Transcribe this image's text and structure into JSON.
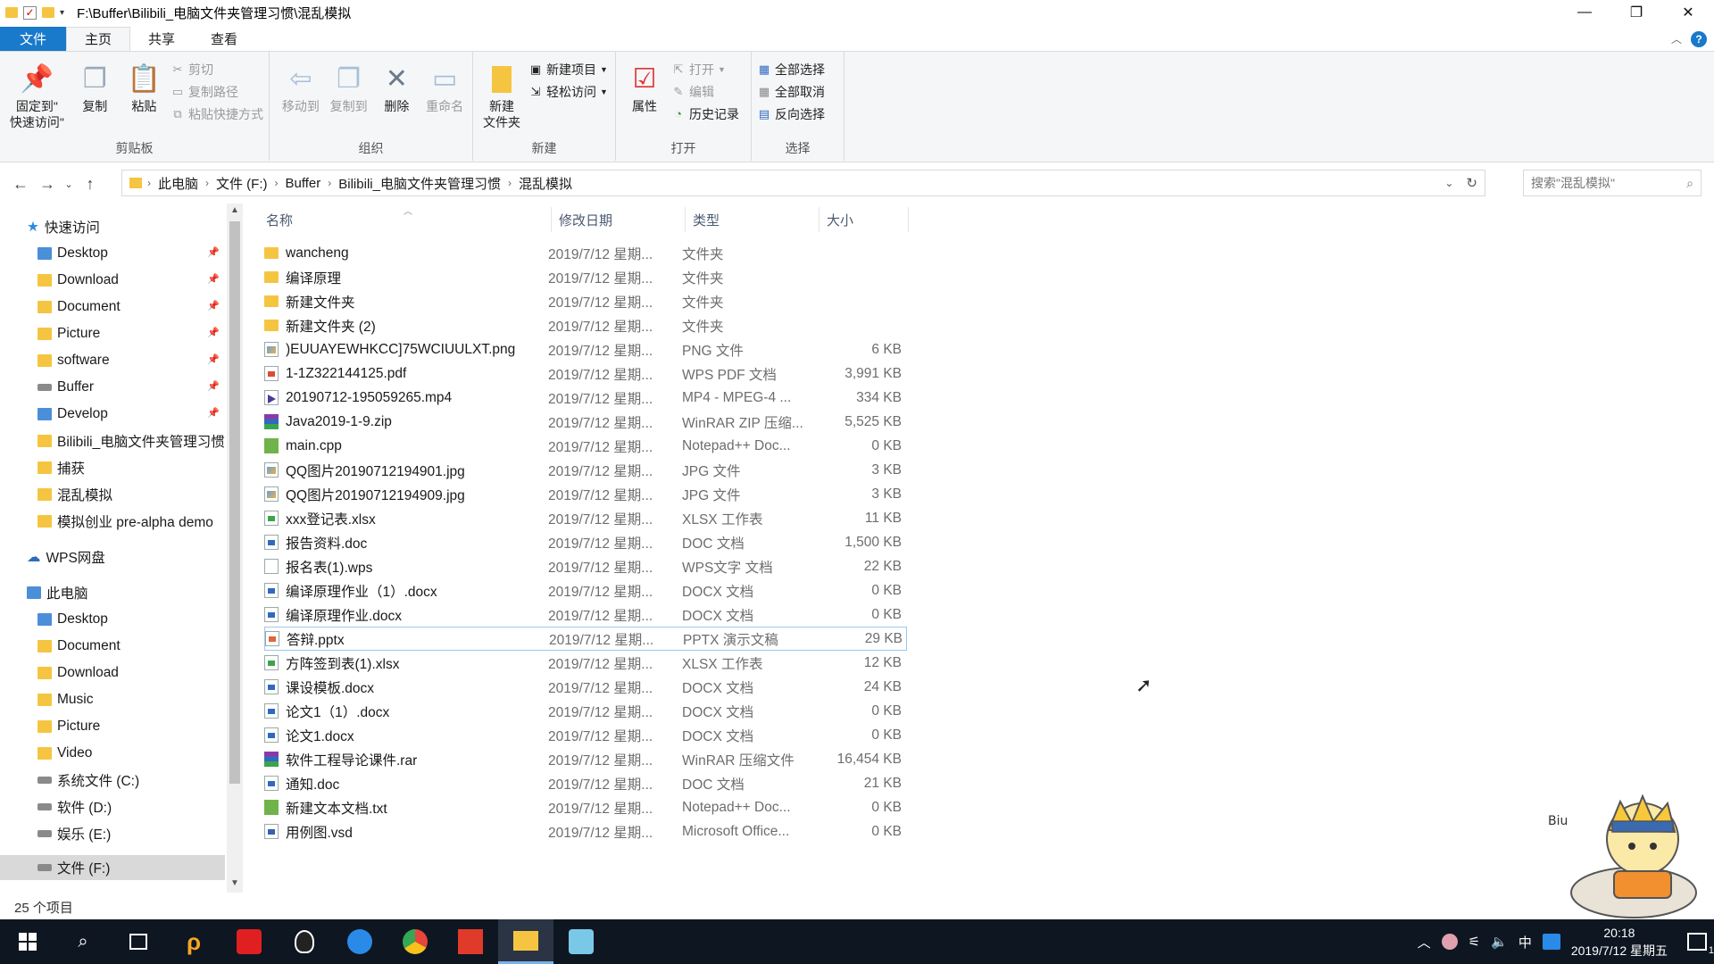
{
  "window": {
    "title": "F:\\Buffer\\Bilibili_电脑文件夹管理习惯\\混乱模拟",
    "controls": [
      "minimize",
      "restore",
      "close"
    ]
  },
  "tabs": [
    {
      "label": "文件"
    },
    {
      "label": "主页"
    },
    {
      "label": "共享"
    },
    {
      "label": "查看"
    }
  ],
  "ribbon": {
    "clipboard": {
      "label": "剪贴板",
      "pin_quick": "固定到\"\n快速访问\"",
      "copy": "复制",
      "paste": "粘贴",
      "cut": "剪切",
      "copy_path": "复制路径",
      "paste_shortcut": "粘贴快捷方式"
    },
    "organize": {
      "label": "组织",
      "move_to": "移动到",
      "copy_to": "复制到",
      "delete": "删除",
      "rename": "重命名"
    },
    "new": {
      "label": "新建",
      "new_folder": "新建\n文件夹",
      "new_item": "新建项目",
      "easy_access": "轻松访问"
    },
    "open": {
      "label": "打开",
      "properties": "属性",
      "open": "打开",
      "edit": "编辑",
      "history": "历史记录"
    },
    "select": {
      "label": "选择",
      "select_all": "全部选择",
      "select_none": "全部取消",
      "invert": "反向选择"
    }
  },
  "address": {
    "crumbs": [
      "此电脑",
      "文件 (F:)",
      "Buffer",
      "Bilibili_电脑文件夹管理习惯",
      "混乱模拟"
    ],
    "search_placeholder": "搜索\"混乱模拟\""
  },
  "nav": {
    "quick_access": "快速访问",
    "quick_items": [
      "Desktop",
      "Download",
      "Document",
      "Picture",
      "software",
      "Buffer",
      "Develop",
      "Bilibili_电脑文件夹管理习惯",
      "捕获",
      "混乱模拟",
      "模拟创业 pre-alpha demo"
    ],
    "wps": "WPS网盘",
    "this_pc": "此电脑",
    "pc_items": [
      "Desktop",
      "Document",
      "Download",
      "Music",
      "Picture",
      "Video",
      "系统文件 (C:)",
      "软件 (D:)",
      "娱乐 (E:)",
      "文件 (F:)"
    ]
  },
  "columns": {
    "name": "名称",
    "date": "修改日期",
    "type": "类型",
    "size": "大小"
  },
  "files": [
    {
      "name": "wancheng",
      "date": "2019/7/12 星期...",
      "type": "文件夹",
      "size": "",
      "icon": "folder"
    },
    {
      "name": "编译原理",
      "date": "2019/7/12 星期...",
      "type": "文件夹",
      "size": "",
      "icon": "folder"
    },
    {
      "name": "新建文件夹",
      "date": "2019/7/12 星期...",
      "type": "文件夹",
      "size": "",
      "icon": "folder"
    },
    {
      "name": "新建文件夹 (2)",
      "date": "2019/7/12 星期...",
      "type": "文件夹",
      "size": "",
      "icon": "folder"
    },
    {
      "name": ")EUUAYEWHKCC]75WCIUULXT.png",
      "date": "2019/7/12 星期...",
      "type": "PNG 文件",
      "size": "6 KB",
      "icon": "img"
    },
    {
      "name": "1-1Z322144125.pdf",
      "date": "2019/7/12 星期...",
      "type": "WPS PDF 文档",
      "size": "3,991 KB",
      "icon": "pdf"
    },
    {
      "name": "20190712-195059265.mp4",
      "date": "2019/7/12 星期...",
      "type": "MP4 - MPEG-4 ...",
      "size": "334 KB",
      "icon": "vid"
    },
    {
      "name": "Java2019-1-9.zip",
      "date": "2019/7/12 星期...",
      "type": "WinRAR ZIP 压缩...",
      "size": "5,525 KB",
      "icon": "zip"
    },
    {
      "name": "main.cpp",
      "date": "2019/7/12 星期...",
      "type": "Notepad++ Doc...",
      "size": "0 KB",
      "icon": "code"
    },
    {
      "name": "QQ图片20190712194901.jpg",
      "date": "2019/7/12 星期...",
      "type": "JPG 文件",
      "size": "3 KB",
      "icon": "img"
    },
    {
      "name": "QQ图片20190712194909.jpg",
      "date": "2019/7/12 星期...",
      "type": "JPG 文件",
      "size": "3 KB",
      "icon": "img"
    },
    {
      "name": "xxx登记表.xlsx",
      "date": "2019/7/12 星期...",
      "type": "XLSX 工作表",
      "size": "11 KB",
      "icon": "xls"
    },
    {
      "name": "报告资料.doc",
      "date": "2019/7/12 星期...",
      "type": "DOC 文档",
      "size": "1,500 KB",
      "icon": "word"
    },
    {
      "name": "报名表(1).wps",
      "date": "2019/7/12 星期...",
      "type": "WPS文字 文档",
      "size": "22 KB",
      "icon": "blank"
    },
    {
      "name": "编译原理作业（1）.docx",
      "date": "2019/7/12 星期...",
      "type": "DOCX 文档",
      "size": "0 KB",
      "icon": "word"
    },
    {
      "name": "编译原理作业.docx",
      "date": "2019/7/12 星期...",
      "type": "DOCX 文档",
      "size": "0 KB",
      "icon": "word"
    },
    {
      "name": "答辩.pptx",
      "date": "2019/7/12 星期...",
      "type": "PPTX 演示文稿",
      "size": "29 KB",
      "icon": "ppt",
      "selected": true
    },
    {
      "name": "方阵签到表(1).xlsx",
      "date": "2019/7/12 星期...",
      "type": "XLSX 工作表",
      "size": "12 KB",
      "icon": "xls"
    },
    {
      "name": "课设模板.docx",
      "date": "2019/7/12 星期...",
      "type": "DOCX 文档",
      "size": "24 KB",
      "icon": "word"
    },
    {
      "name": "论文1（1）.docx",
      "date": "2019/7/12 星期...",
      "type": "DOCX 文档",
      "size": "0 KB",
      "icon": "word"
    },
    {
      "name": "论文1.docx",
      "date": "2019/7/12 星期...",
      "type": "DOCX 文档",
      "size": "0 KB",
      "icon": "word"
    },
    {
      "name": "软件工程导论课件.rar",
      "date": "2019/7/12 星期...",
      "type": "WinRAR 压缩文件",
      "size": "16,454 KB",
      "icon": "zip"
    },
    {
      "name": "通知.doc",
      "date": "2019/7/12 星期...",
      "type": "DOC 文档",
      "size": "21 KB",
      "icon": "word"
    },
    {
      "name": "新建文本文档.txt",
      "date": "2019/7/12 星期...",
      "type": "Notepad++ Doc...",
      "size": "0 KB",
      "icon": "code"
    },
    {
      "name": "用例图.vsd",
      "date": "2019/7/12 星期...",
      "type": "Microsoft Office...",
      "size": "0 KB",
      "icon": "vsd"
    }
  ],
  "status": {
    "count": "25 个项目"
  },
  "taskbar": {
    "ime": "中",
    "time": "20:18",
    "date": "2019/7/12 星期五",
    "notification_count": "1"
  },
  "colors": {
    "accent": "#1979ca",
    "taskbar": "#0e1621",
    "ribbon_bg": "#f5f6f7"
  }
}
